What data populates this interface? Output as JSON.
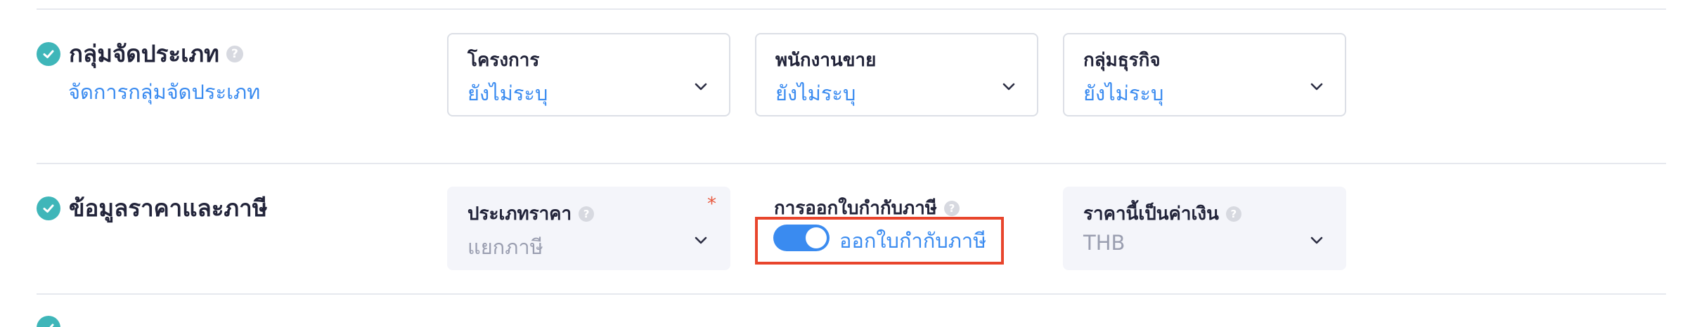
{
  "group_section": {
    "title": "กลุ่มจัดประเภท",
    "help": "?",
    "manage_link": "จัดการกลุ่มจัดประเภท",
    "fields": [
      {
        "label": "โครงการ",
        "value": "ยังไม่ระบุ"
      },
      {
        "label": "พนักงานขาย",
        "value": "ยังไม่ระบุ"
      },
      {
        "label": "กลุ่มธุรกิจ",
        "value": "ยังไม่ระบุ"
      }
    ]
  },
  "price_tax_section": {
    "title": "ข้อมูลราคาและภาษี",
    "price_type": {
      "label": "ประเภทราคา",
      "help": "?",
      "required_mark": "*",
      "value": "แยกภาษี"
    },
    "tax_invoice": {
      "label": "การออกใบกำกับภาษี",
      "help": "?",
      "toggle_on": true,
      "toggle_text": "ออกใบกำกับภาษี"
    },
    "currency": {
      "label": "ราคานี้เป็นค่าเงิน",
      "help": "?",
      "value": "THB"
    }
  },
  "colors": {
    "accent_blue": "#3a8bf0",
    "check_teal": "#3fb6b9",
    "highlight_red": "#e8452c",
    "required_red": "#e8583d"
  },
  "icons": [
    "check-circle-icon",
    "help-icon",
    "chevron-down-icon"
  ]
}
